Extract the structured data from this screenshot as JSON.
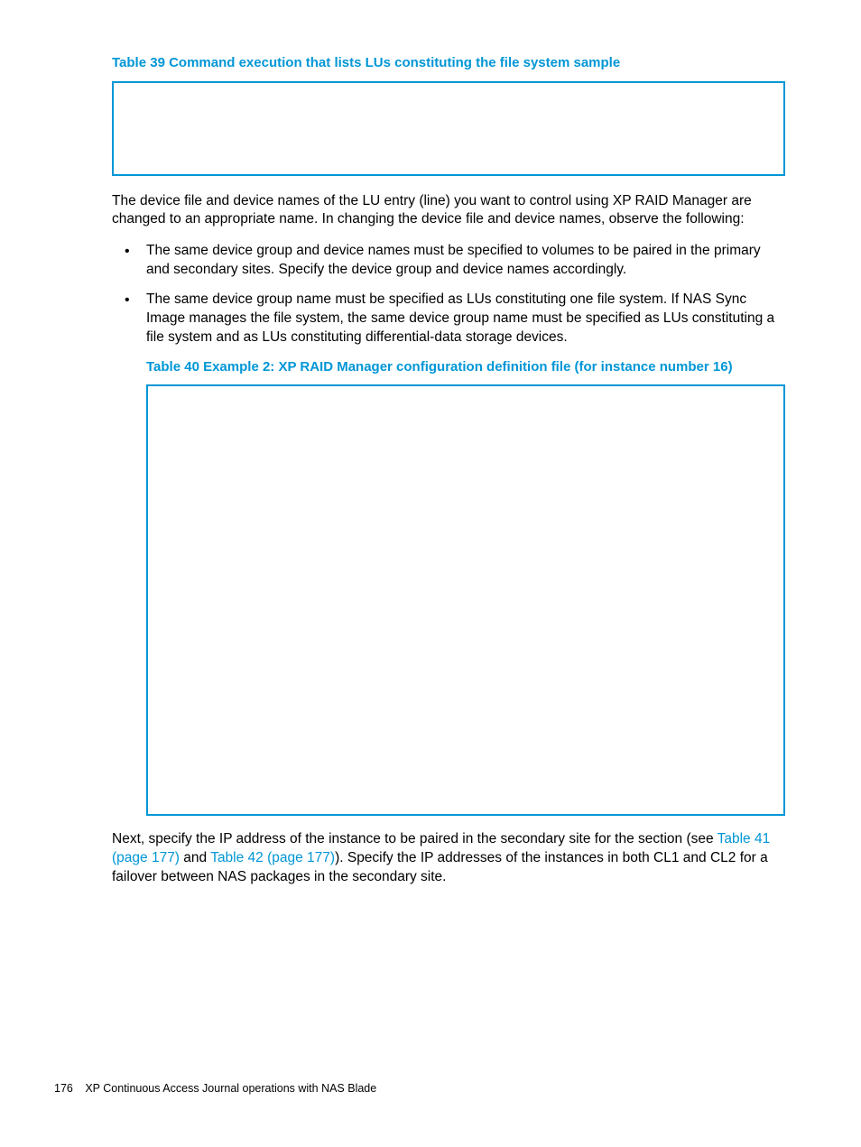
{
  "captions": {
    "table39": "Table 39 Command execution that lists LUs constituting the file system sample",
    "table40": "Table 40 Example 2: XP RAID Manager configuration definition file (for instance number 16)"
  },
  "paragraphs": {
    "p1": "The device file and device names of the LU entry (line) you want to control using XP RAID Manager are changed to an appropriate name. In changing the device file and device names, observe the following:",
    "p2_pre": "Next, specify the IP address of the instance to be paired in the secondary site for the section (see ",
    "p2_mid": " and ",
    "p2_post": "). Specify the IP addresses of the instances in both CL1 and CL2 for a failover between NAS packages in the secondary site."
  },
  "bullets": {
    "b1": "The same device group and device names must be specified to volumes to be paired in the primary and secondary sites. Specify the device group and device names accordingly.",
    "b2": "The same device group name must be specified as LUs constituting one file system. If NAS Sync Image manages the file system, the same device group name must be specified as LUs constituting a file system and as LUs constituting differential-data storage devices."
  },
  "links": {
    "t41": "Table 41 (page 177)",
    "t42": "Table 42 (page 177)"
  },
  "footer": {
    "page_number": "176",
    "section": "XP Continuous Access Journal operations with NAS Blade"
  }
}
